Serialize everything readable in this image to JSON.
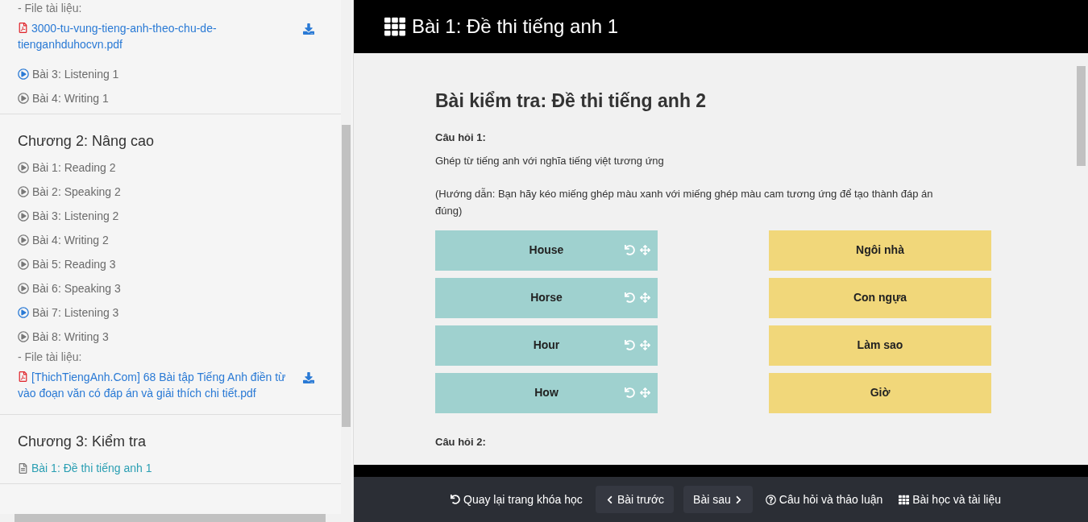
{
  "sidebar": {
    "sections": [
      {
        "items": [
          {
            "kind": "file_label",
            "text": "- File tài liệu:"
          },
          {
            "kind": "file",
            "text": "3000-tu-vung-tieng-anh-theo-chu-de-tienganhduhocvn.pdf"
          },
          {
            "kind": "audio",
            "text": "Bài 3: Listening 1",
            "selected": false
          },
          {
            "kind": "video",
            "text": "Bài 4: Writing 1",
            "selected": false
          }
        ]
      },
      {
        "title": "Chương 2: Nâng cao",
        "items": [
          {
            "kind": "video",
            "text": "Bài 1: Reading 2",
            "selected": false
          },
          {
            "kind": "video",
            "text": "Bài 2: Speaking 2",
            "selected": false
          },
          {
            "kind": "video",
            "text": "Bài 3: Listening 2",
            "selected": false
          },
          {
            "kind": "video",
            "text": "Bài 4: Writing 2",
            "selected": false
          },
          {
            "kind": "video",
            "text": "Bài 5: Reading 3",
            "selected": false
          },
          {
            "kind": "video",
            "text": "Bài 6: Speaking 3",
            "selected": false
          },
          {
            "kind": "audio",
            "text": "Bài 7: Listening 3",
            "selected": false
          },
          {
            "kind": "video",
            "text": "Bài 8: Writing 3",
            "selected": false
          },
          {
            "kind": "file_label",
            "text": "- File tài liệu:"
          },
          {
            "kind": "file",
            "text": "[ThichTiengAnh.Com] 68 Bài tập Tiếng Anh điền từ vào đoạn văn có đáp án và giải thích chi tiết.pdf"
          }
        ]
      },
      {
        "title": "Chương 3: Kiểm tra",
        "items": [
          {
            "kind": "test",
            "text": "Bài 1: Đề thi tiếng anh 1",
            "selected": true
          }
        ]
      }
    ]
  },
  "header": {
    "title": "Bài 1: Đề thi tiếng anh 1"
  },
  "quiz": {
    "title": "Bài kiểm tra: Đề thi tiếng anh 2",
    "questions": [
      {
        "label": "Câu hỏi 1:",
        "prompt": "Ghép từ tiếng anh với nghĩa tiếng việt tương ứng",
        "hint": "(Hướng dẫn: Bạn hãy kéo miếng ghép màu xanh với miếng ghép màu cam tương ứng để tạo thành đáp án đúng)",
        "left": [
          "House",
          "Horse",
          "Hour",
          "How"
        ],
        "right": [
          "Ngôi nhà",
          "Con ngựa",
          "Làm sao",
          "Giờ"
        ]
      },
      {
        "label": "Câu hỏi 2:"
      }
    ]
  },
  "footer": {
    "back": "Quay lại trang khóa học",
    "prev": "Bài trước",
    "next": "Bài sau",
    "discussion": "Câu hỏi và thảo luận",
    "materials": "Bài học và tài liệu"
  }
}
